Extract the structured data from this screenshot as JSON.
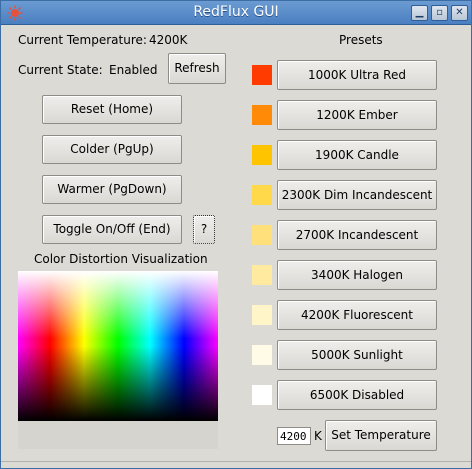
{
  "window": {
    "title": "RedFlux GUI"
  },
  "status": {
    "temperature_label": "Current Temperature:",
    "temperature_value": "4200K",
    "state_label": "Current State:",
    "state_value": "Enabled",
    "refresh_label": "Refresh"
  },
  "controls": {
    "reset_label": "Reset (Home)",
    "colder_label": "Colder (PgUp)",
    "warmer_label": "Warmer (PgDown)",
    "toggle_label": "Toggle On/Off (End)",
    "help_label": "?"
  },
  "visualization": {
    "title": "Color Distortion Visualization"
  },
  "presets": {
    "title": "Presets",
    "items": [
      {
        "label": "1000K Ultra Red",
        "color": "#ff3b00"
      },
      {
        "label": "1200K Ember",
        "color": "#ff8a08"
      },
      {
        "label": "1900K Candle",
        "color": "#ffc400"
      },
      {
        "label": "2300K Dim Incandescent",
        "color": "#ffd94a"
      },
      {
        "label": "2700K Incandescent",
        "color": "#ffe07a"
      },
      {
        "label": "3400K Halogen",
        "color": "#ffeaa0"
      },
      {
        "label": "4200K Fluorescent",
        "color": "#fff5c8"
      },
      {
        "label": "5000K Sunlight",
        "color": "#fffbe6"
      },
      {
        "label": "6500K Disabled",
        "color": "#ffffff"
      }
    ]
  },
  "set_temperature": {
    "input_value": "4200",
    "unit": "K",
    "button_label": "Set Temperature"
  },
  "colors": {
    "titlebar": "#4a7fc1",
    "background": "#dcdad5"
  }
}
